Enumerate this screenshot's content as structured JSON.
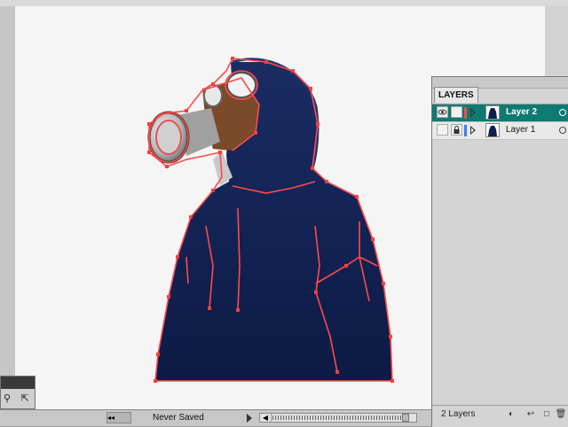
{
  "layers_panel": {
    "tab_label": "LAYERS",
    "layers": [
      {
        "name": "Layer 2",
        "selected": true,
        "visible": true,
        "locked": false,
        "color": "#ff4d4d"
      },
      {
        "name": "Layer 1",
        "selected": false,
        "visible": false,
        "locked": true,
        "color": "#3a7bff"
      }
    ],
    "layer_count": "2 Layers",
    "footer_icons": [
      "make-clipping-mask-icon",
      "create-sublayer-icon",
      "new-layer-icon",
      "delete-layer-icon"
    ]
  },
  "status_bar": {
    "status_text": "Never Saved",
    "nav_label": "◂◂"
  },
  "artwork": {
    "description_icon": "hoodie-figure-with-gas-mask",
    "path_color": "#ff4a4a",
    "hoodie_color": "#0d1f4a",
    "mask_color": "#7a4a2a"
  },
  "tools": [
    "zoom-tool-icon",
    "direct-select-icon"
  ],
  "colors": {
    "selected_row": "#0e7a72",
    "artboard": "#f5f5f5"
  }
}
